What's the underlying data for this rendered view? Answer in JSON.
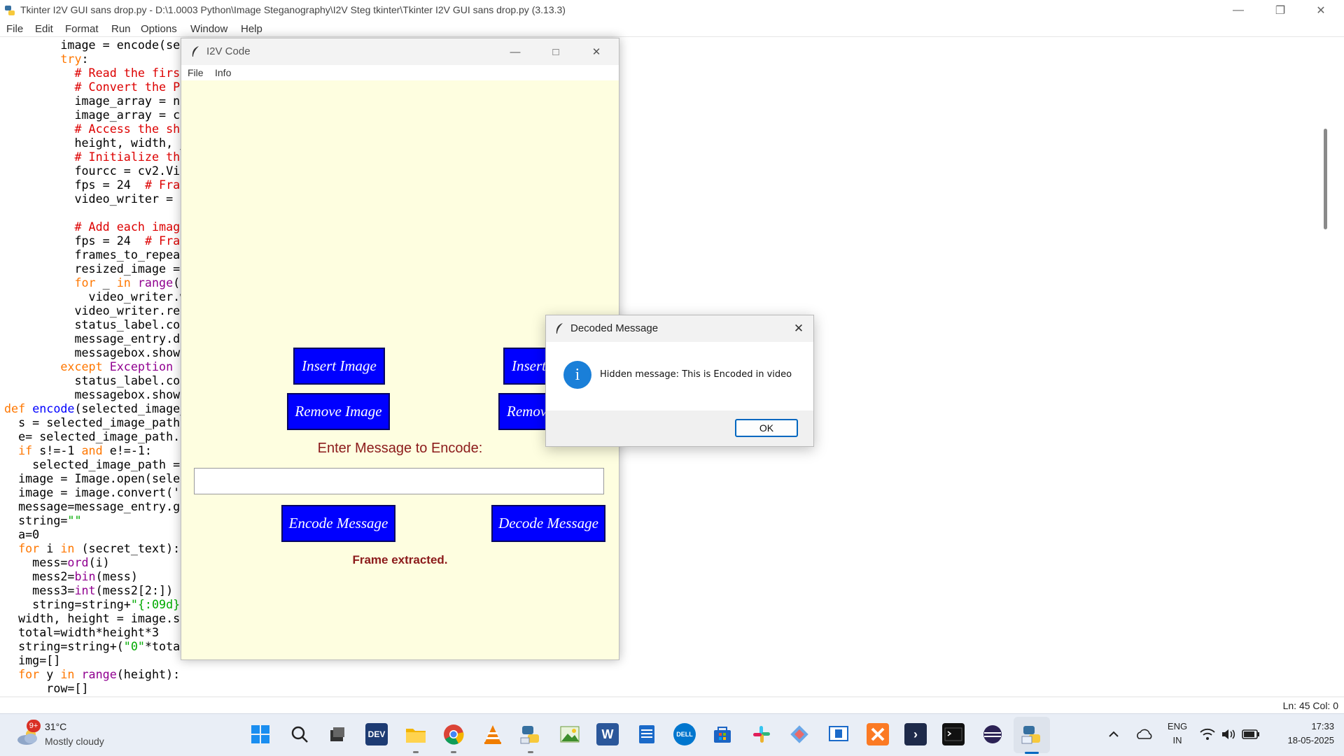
{
  "idle": {
    "title": "Tkinter I2V GUI sans drop.py - D:\\1.0003 Python\\Image Steganography\\I2V Steg tkinter\\Tkinter I2V GUI sans drop.py (3.13.3)",
    "menu": [
      "File",
      "Edit",
      "Format",
      "Run",
      "Options",
      "Window",
      "Help"
    ],
    "code_lines": [
      [
        [
          "",
          "        image = encode(se"
        ]
      ],
      [
        [
          "kw",
          "        try"
        ],
        [
          "",
          ":"
        ]
      ],
      [
        [
          "cm",
          "          # Read the firs"
        ]
      ],
      [
        [
          "cm",
          "          # Convert the P"
        ]
      ],
      [
        [
          "",
          "          image_array = nj"
        ]
      ],
      [
        [
          "",
          "          image_array = cv"
        ]
      ],
      [
        [
          "cm",
          "          # Access the sha"
        ]
      ],
      [
        [
          "",
          "          height, width, _"
        ]
      ],
      [
        [
          "cm",
          "          # Initialize the"
        ]
      ],
      [
        [
          "",
          "          fourcc = cv2.Vid"
        ]
      ],
      [
        [
          "",
          "          fps = 24  "
        ],
        [
          "cm",
          "# Fra"
        ]
      ],
      [
        [
          "",
          "          video_writer = c"
        ]
      ],
      [
        [
          "",
          ""
        ]
      ],
      [
        [
          "cm",
          "          # Add each image"
        ]
      ],
      [
        [
          "",
          "          fps = 24  "
        ],
        [
          "cm",
          "# Fra"
        ]
      ],
      [
        [
          "",
          "          frames_to_repeat"
        ]
      ],
      [
        [
          "",
          "          resized_image = "
        ]
      ],
      [
        [
          "kw",
          "          for"
        ],
        [
          "",
          " _ "
        ],
        [
          "kw",
          "in"
        ],
        [
          "",
          " "
        ],
        [
          "bi",
          "range"
        ],
        [
          "",
          "("
        ]
      ],
      [
        [
          "",
          "            video_writer.w"
        ]
      ],
      [
        [
          "",
          "          video_writer.rel"
        ]
      ],
      [
        [
          "",
          "          status_label.con"
        ]
      ],
      [
        [
          "",
          "          message_entry.de"
        ]
      ],
      [
        [
          "",
          "          messagebox.showi"
        ]
      ],
      [
        [
          "kw",
          "        except"
        ],
        [
          "",
          " "
        ],
        [
          "bi",
          "Exception"
        ],
        [
          "",
          " a"
        ]
      ],
      [
        [
          "",
          "          status_label.con"
        ]
      ],
      [
        [
          "",
          "          messagebox.showe"
        ]
      ],
      [
        [
          "kw",
          "def"
        ],
        [
          "",
          " "
        ],
        [
          "fn",
          "encode"
        ],
        [
          "",
          "(selected_image_"
        ]
      ],
      [
        [
          "",
          "  s = selected_image_path"
        ]
      ],
      [
        [
          "",
          "  e= selected_image_path."
        ]
      ],
      [
        [
          "kw",
          "  if"
        ],
        [
          "",
          " s!=-1 "
        ],
        [
          "kw",
          "and"
        ],
        [
          "",
          " e!=-1:"
        ]
      ],
      [
        [
          "",
          "    selected_image_path ="
        ]
      ],
      [
        [
          "",
          "  image = Image.open(sele"
        ]
      ],
      [
        [
          "",
          "  image = image.convert('"
        ]
      ],
      [
        [
          "",
          "  message=message_entry.ge"
        ]
      ],
      [
        [
          "",
          "  string="
        ],
        [
          "st",
          "\"\""
        ]
      ],
      [
        [
          "",
          "  a=0"
        ]
      ],
      [
        [
          "kw",
          "  for"
        ],
        [
          "",
          " i "
        ],
        [
          "kw",
          "in"
        ],
        [
          "",
          " (secret_text):"
        ]
      ],
      [
        [
          "",
          "    mess="
        ],
        [
          "bi",
          "ord"
        ],
        [
          "",
          "(i)"
        ]
      ],
      [
        [
          "",
          "    mess2="
        ],
        [
          "bi",
          "bin"
        ],
        [
          "",
          "(mess)"
        ]
      ],
      [
        [
          "",
          "    mess3="
        ],
        [
          "bi",
          "int"
        ],
        [
          "",
          "(mess2[2:])"
        ]
      ],
      [
        [
          "",
          "    string=string+"
        ],
        [
          "st",
          "\"{:09d}"
        ]
      ],
      [
        [
          "",
          "  width, height = image.si"
        ]
      ],
      [
        [
          "",
          "  total=width*height*3"
        ]
      ],
      [
        [
          "",
          "  string=string+("
        ],
        [
          "st",
          "\"0\""
        ],
        [
          "",
          "*tota"
        ]
      ],
      [
        [
          "",
          "  img=[]"
        ]
      ],
      [
        [
          "kw",
          "  for"
        ],
        [
          "",
          " y "
        ],
        [
          "kw",
          "in"
        ],
        [
          "",
          " "
        ],
        [
          "bi",
          "range"
        ],
        [
          "",
          "(height):"
        ]
      ],
      [
        [
          "",
          "      row=[]"
        ]
      ]
    ],
    "status": "Ln: 45   Col: 0"
  },
  "i2v": {
    "title": "I2V Code",
    "menu_file": "File",
    "menu_info": "Info",
    "insert_image": "Insert Image",
    "insert_video": "Insert",
    "remove_image": "Remove Image",
    "remove_video": "Remov",
    "enter_label": "Enter Message to Encode:",
    "message_value": "",
    "encode_btn": "Encode Message",
    "decode_btn": "Decode Message",
    "status": "Frame extracted."
  },
  "dialog": {
    "title": "Decoded Message",
    "message": "Hidden message: This is Encoded in video",
    "ok": "OK",
    "icon_glyph": "i"
  },
  "taskbar": {
    "badge": "9+",
    "temp": "31°C",
    "weather": "Mostly cloudy",
    "lang1": "ENG",
    "lang2": "IN",
    "time": "17:33",
    "date": "18-05-2025",
    "dev_label": "DEV",
    "dell_label": "DELL",
    "apps": [
      "start-icon",
      "search-icon",
      "task-view-icon",
      "dev-home-icon",
      "file-explorer-icon",
      "chrome-icon",
      "vlc-icon",
      "python-idle-icon",
      "image-viewer-icon",
      "word-icon",
      "notepad-icon",
      "dell-icon",
      "microsoft-store-icon",
      "slack-icon",
      "git-icon",
      "remote-desktop-icon",
      "xampp-icon",
      "powershell-icon",
      "terminal-icon",
      "eclipse-icon",
      "python-active-icon"
    ]
  },
  "colors": {
    "keyword": "#ff7700",
    "comment": "#dd0000",
    "builtin": "#900090",
    "string": "#00aa00",
    "function": "#0000ff",
    "tk_bg": "#fefee0",
    "button_bg": "#0000ff",
    "label_red": "#8b1a1a"
  }
}
